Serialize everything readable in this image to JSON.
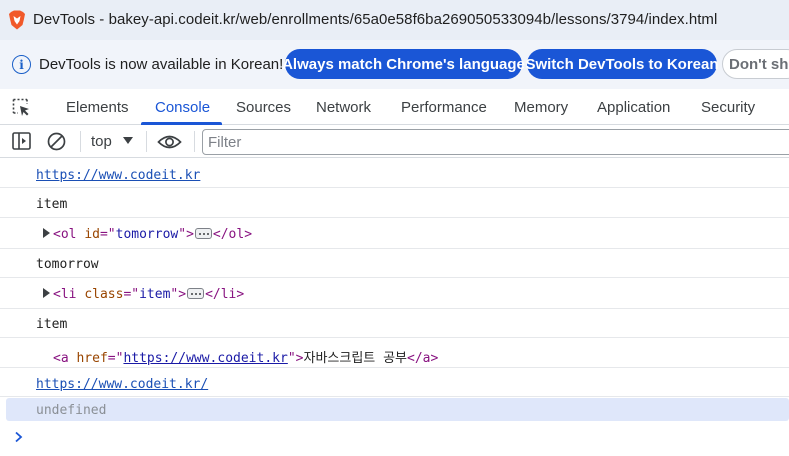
{
  "window": {
    "title": "DevTools - bakey-api.codeit.kr/web/enrollments/65a0e58f6ba269050533094b/lessons/3794/index.html"
  },
  "infobar": {
    "message": "DevTools is now available in Korean!",
    "match_button": "Always match Chrome's language",
    "switch_button": "Switch DevTools to Korean",
    "dismiss_button": "Don't show again"
  },
  "tabs": [
    {
      "label": "Elements"
    },
    {
      "label": "Console"
    },
    {
      "label": "Sources"
    },
    {
      "label": "Network"
    },
    {
      "label": "Performance"
    },
    {
      "label": "Memory"
    },
    {
      "label": "Application"
    },
    {
      "label": "Security"
    }
  ],
  "active_tab": "Console",
  "toolbar": {
    "context": "top",
    "filter_placeholder": "Filter"
  },
  "console": {
    "line1": "https://www.codeit.kr",
    "line2": "item",
    "line3": {
      "tag_open": "<ol ",
      "attr": "id",
      "eq": "=\"",
      "value": "tomorrow",
      "close": "\">",
      "tag_end": "</ol>"
    },
    "line4": "tomorrow",
    "line5": {
      "tag_open": "<li ",
      "attr": "class",
      "eq": "=\"",
      "value": "item",
      "close": "\">",
      "tag_end": "</li>"
    },
    "line6": "item",
    "line7": {
      "tag_open": "<a ",
      "attr": "href",
      "eq": "=\"",
      "value": "https://www.codeit.kr",
      "close": "\">",
      "text": "자바스크립트 공부",
      "tag_end": "</a>"
    },
    "line8": "https://www.codeit.kr/",
    "result": "undefined"
  },
  "colors": {
    "accent": "#1a56d6",
    "titlebar_bg": "#e9eef6",
    "result_bg": "#dfe7fa"
  }
}
